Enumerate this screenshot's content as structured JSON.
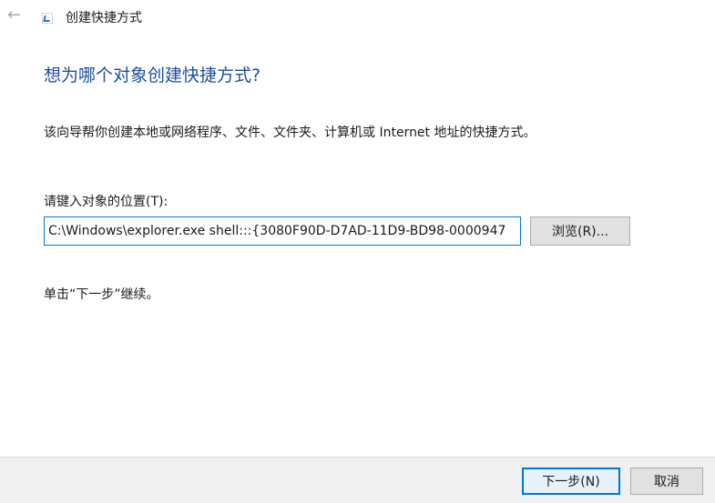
{
  "window": {
    "title": "创建快捷方式",
    "icons": {
      "back": "back-arrow-icon",
      "app": "shortcut-icon"
    }
  },
  "main": {
    "heading": "想为哪个对象创建快捷方式?",
    "description": "该向导帮你创建本地或网络程序、文件、文件夹、计算机或 Internet 地址的快捷方式。",
    "location_label": "请键入对象的位置(T):",
    "location_value": "C:\\Windows\\explorer.exe shell:::{3080F90D-D7AD-11D9-BD98-0000947",
    "browse_label": "浏览(R)...",
    "hint": "单击“下一步”继续。"
  },
  "footer": {
    "next_label": "下一步(N)",
    "cancel_label": "取消"
  },
  "colors": {
    "heading": "#1d4f9c",
    "accent": "#0078d7",
    "footer_bg": "#f0f0f0"
  }
}
